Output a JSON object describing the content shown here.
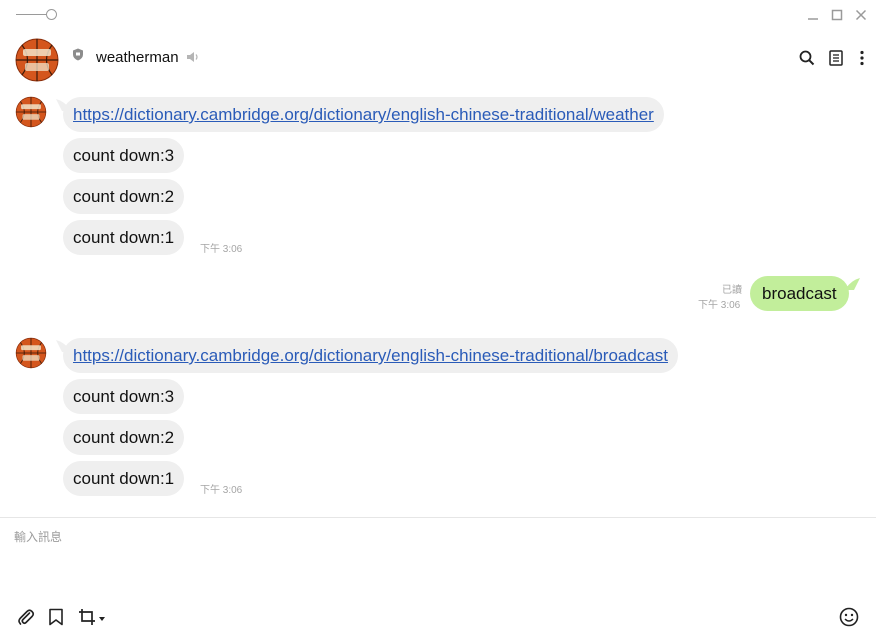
{
  "header": {
    "chat_name": "weatherman"
  },
  "messages": [
    {
      "side": "left",
      "type": "link",
      "text": "https://dictionary.cambridge.org/dictionary/english-chinese-traditional/weather"
    },
    {
      "side": "left",
      "type": "text",
      "text": "count down:3"
    },
    {
      "side": "left",
      "type": "text",
      "text": "count down:2"
    },
    {
      "side": "left",
      "type": "text",
      "text": "count down:1",
      "time": "下午 3:06"
    },
    {
      "side": "right",
      "type": "text",
      "text": "broadcast",
      "read": "已讀",
      "time": "下午 3:06"
    },
    {
      "side": "left",
      "type": "link",
      "text": "https://dictionary.cambridge.org/dictionary/english-chinese-traditional/broadcast"
    },
    {
      "side": "left",
      "type": "text",
      "text": "count down:3"
    },
    {
      "side": "left",
      "type": "text",
      "text": "count down:2"
    },
    {
      "side": "left",
      "type": "text",
      "text": "count down:1",
      "time": "下午 3:06"
    }
  ],
  "composer": {
    "placeholder": "輸入訊息"
  },
  "colors": {
    "incoming_bubble": "#efefef",
    "outgoing_bubble": "#c2ee9b",
    "link": "#2a5bb8"
  },
  "icons": {
    "avatar": "basketball-avatar",
    "title_left": "zoom-slider",
    "window": [
      "minimize-icon",
      "maximize-icon",
      "close-icon"
    ],
    "header_right": [
      "search-icon",
      "notes-icon",
      "more-icon"
    ],
    "toolbar": [
      "paperclip-icon",
      "bookmark-icon",
      "crop-icon",
      "emoji-icon"
    ]
  }
}
